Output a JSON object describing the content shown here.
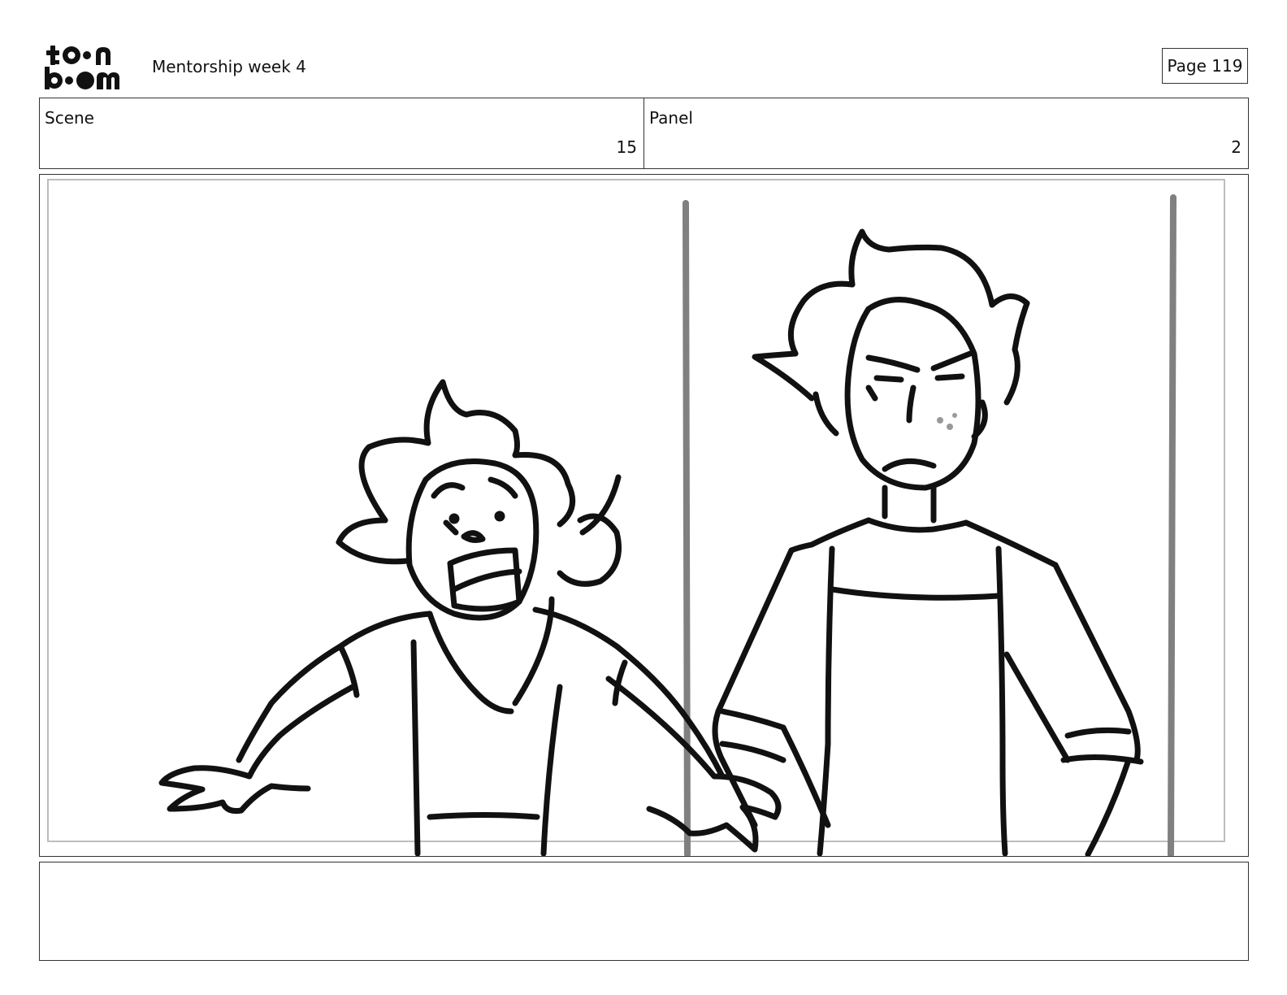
{
  "header": {
    "logo_icon": "toon-boom-logo",
    "project_title": "Mentorship week 4",
    "page_label": "Page 119"
  },
  "info": {
    "scene_label": "Scene",
    "scene_value": "15",
    "panel_label": "Panel",
    "panel_value": "2"
  },
  "panel": {
    "drawing": "storyboard-sketch",
    "line_color": "#111111",
    "pillar_color": "#808080"
  },
  "notes": {
    "text": ""
  }
}
